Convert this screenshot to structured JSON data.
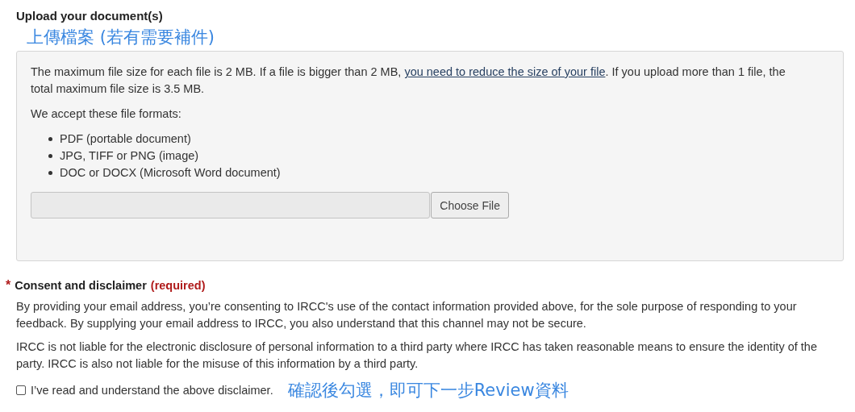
{
  "upload": {
    "title": "Upload your document(s)",
    "annotation": "上傳檔案 (若有需要補件)",
    "size_note": {
      "before": "The maximum file size for each file is 2 MB. If a file is bigger than 2 MB, ",
      "link": "you need to reduce the size of your file",
      "after": ". If you upload more than 1 file, the total maximum file size is 3.5 MB."
    },
    "formats_intro": "We accept these file formats:",
    "formats": [
      "PDF (portable document)",
      "JPG, TIFF or PNG (image)",
      "DOC or DOCX (Microsoft Word document)"
    ],
    "choose_button": "Choose File"
  },
  "consent": {
    "required_mark": "*",
    "title": "Consent and disclaimer",
    "required_label": "(required)",
    "paragraphs": [
      "By providing your email address, you’re consenting to IRCC's use of the contact information provided above, for the sole purpose of responding to your feedback. By supplying your email address to IRCC, you also understand that this channel may not be secure.",
      "IRCC is not liable for the electronic disclosure of personal information to a third party where IRCC has taken reasonable means to ensure the identity of the party. IRCC is also not liable for the misuse of this information by a third party."
    ],
    "checkbox": {
      "label": "I’ve read and understand the above disclaimer.",
      "checked": false
    },
    "annotation": "確認後勾選，即可下一步Review資料"
  }
}
